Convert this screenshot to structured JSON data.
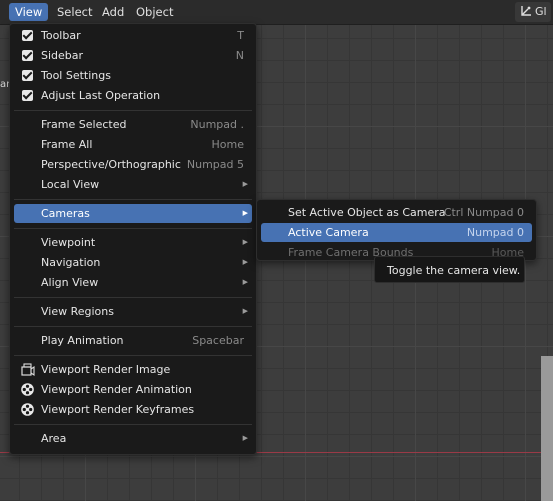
{
  "header": {
    "menus": [
      "View",
      "Select",
      "Add",
      "Object"
    ],
    "active_menu": "View",
    "right_button": "Gl"
  },
  "left_stub": "ar",
  "view_menu": {
    "items": [
      {
        "label": "Toolbar",
        "shortcut": "T",
        "checked": true
      },
      {
        "label": "Sidebar",
        "shortcut": "N",
        "checked": true
      },
      {
        "label": "Tool Settings",
        "shortcut": "",
        "checked": true
      },
      {
        "label": "Adjust Last Operation",
        "shortcut": "",
        "checked": true
      },
      {
        "label": "Frame Selected",
        "shortcut": "Numpad ."
      },
      {
        "label": "Frame All",
        "shortcut": "Home"
      },
      {
        "label": "Perspective/Orthographic",
        "shortcut": "Numpad 5"
      },
      {
        "label": "Local View",
        "submenu": true
      },
      {
        "label": "Cameras",
        "submenu": true,
        "highlighted": true
      },
      {
        "label": "Viewpoint",
        "submenu": true
      },
      {
        "label": "Navigation",
        "submenu": true
      },
      {
        "label": "Align View",
        "submenu": true
      },
      {
        "label": "View Regions",
        "submenu": true
      },
      {
        "label": "Play Animation",
        "shortcut": "Spacebar"
      },
      {
        "label": "Viewport Render Image",
        "icon": "render-image-icon"
      },
      {
        "label": "Viewport Render Animation",
        "icon": "film-reel-icon"
      },
      {
        "label": "Viewport Render Keyframes",
        "icon": "film-reel-icon"
      },
      {
        "label": "Area",
        "submenu": true
      }
    ]
  },
  "cameras_menu": {
    "items": [
      {
        "label": "Set Active Object as Camera",
        "shortcut": "Ctrl Numpad 0"
      },
      {
        "label": "Active Camera",
        "shortcut": "Numpad 0",
        "highlighted": true
      },
      {
        "label": "Frame Camera Bounds",
        "shortcut": "Home",
        "disabled": true
      }
    ]
  },
  "tooltip": "Toggle the camera view.",
  "colors": {
    "accent": "#4772b3",
    "menu_bg": "#1a1a1a",
    "axis_red": "#9a3a47"
  }
}
